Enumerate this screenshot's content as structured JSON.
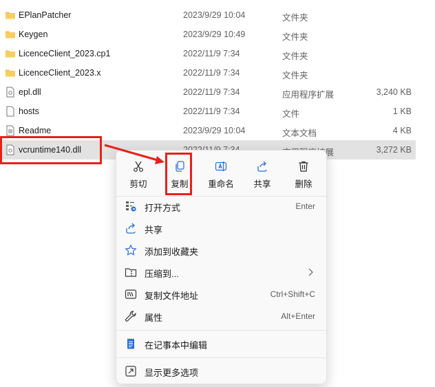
{
  "files": [
    {
      "name": "EPlanPatcher",
      "date": "2023/9/29 10:04",
      "type": "文件夹",
      "size": "",
      "icon": "folder-icon"
    },
    {
      "name": "Keygen",
      "date": "2023/9/29 10:49",
      "type": "文件夹",
      "size": "",
      "icon": "folder-icon"
    },
    {
      "name": "LicenceClient_2023.cp1",
      "date": "2022/11/9 7:34",
      "type": "文件夹",
      "size": "",
      "icon": "folder-icon"
    },
    {
      "name": "LicenceClient_2023.x",
      "date": "2022/11/9 7:34",
      "type": "文件夹",
      "size": "",
      "icon": "folder-icon"
    },
    {
      "name": "epl.dll",
      "date": "2022/11/9 7:34",
      "type": "应用程序扩展",
      "size": "3,240 KB",
      "icon": "dll-file-icon"
    },
    {
      "name": "hosts",
      "date": "2022/11/9 7:34",
      "type": "文件",
      "size": "1 KB",
      "icon": "blank-file-icon"
    },
    {
      "name": "Readme",
      "date": "2023/9/29 10:04",
      "type": "文本文档",
      "size": "4 KB",
      "icon": "text-file-icon"
    },
    {
      "name": "vcruntime140.dll",
      "date": "2022/11/9 7:34",
      "type": "应用程序扩展",
      "size": "3,272 KB",
      "icon": "dll-file-icon"
    }
  ],
  "context_menu": {
    "quick_actions": [
      {
        "label": "剪切",
        "icon": "cut-icon"
      },
      {
        "label": "复制",
        "icon": "copy-icon"
      },
      {
        "label": "重命名",
        "icon": "rename-icon"
      },
      {
        "label": "共享",
        "icon": "share-icon"
      },
      {
        "label": "删除",
        "icon": "delete-icon"
      }
    ],
    "items": [
      {
        "label": "打开方式",
        "shortcut": "Enter",
        "icon": "open-with-icon"
      },
      {
        "label": "共享",
        "shortcut": "",
        "icon": "share-icon"
      },
      {
        "label": "添加到收藏夹",
        "shortcut": "",
        "icon": "star-icon"
      },
      {
        "label": "压缩到...",
        "shortcut": "",
        "icon": "zip-folder-icon",
        "submenu": true
      },
      {
        "label": "复制文件地址",
        "shortcut": "Ctrl+Shift+C",
        "icon": "copy-path-icon"
      },
      {
        "label": "属性",
        "shortcut": "Alt+Enter",
        "icon": "wrench-icon"
      },
      {
        "label": "在记事本中编辑",
        "shortcut": "",
        "icon": "notepad-icon"
      },
      {
        "label": "显示更多选项",
        "shortcut": "",
        "icon": "more-options-icon"
      }
    ]
  },
  "colors": {
    "highlight": "#e8201a",
    "folder": "#f3c04e",
    "accent": "#2a6fd1"
  }
}
